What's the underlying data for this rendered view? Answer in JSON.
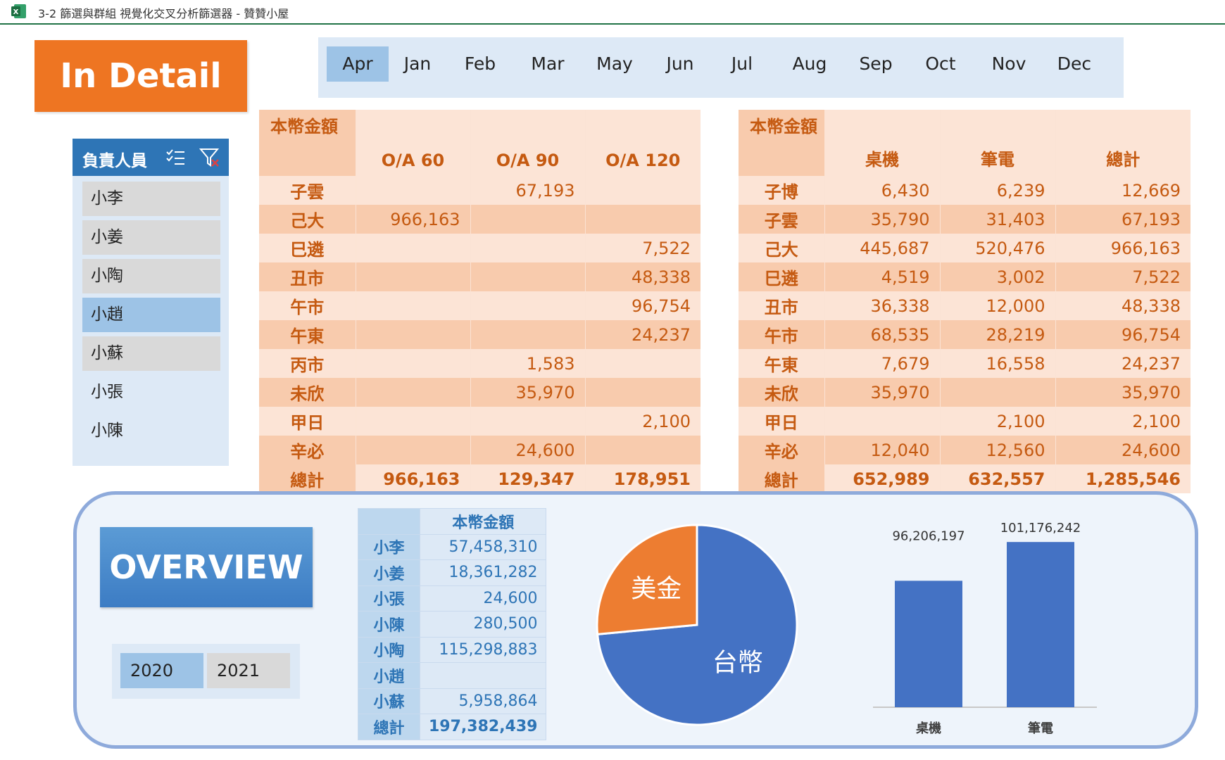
{
  "window": {
    "title": "3-2 篩選與群組 視覺化交叉分析篩選器 - 贊贊小屋",
    "app_icon": "excel-icon"
  },
  "banner": {
    "text": "In Detail"
  },
  "months": {
    "items": [
      "Apr",
      "Jan",
      "Feb",
      "Mar",
      "May",
      "Jun",
      "Jul",
      "Aug",
      "Sep",
      "Oct",
      "Nov",
      "Dec"
    ],
    "selected": "Apr"
  },
  "person_slicer": {
    "title": "負責人員",
    "items": [
      {
        "label": "小李",
        "state": "boxed"
      },
      {
        "label": "小姜",
        "state": "boxed"
      },
      {
        "label": "小陶",
        "state": "boxed"
      },
      {
        "label": "小趙",
        "state": "selected"
      },
      {
        "label": "小蘇",
        "state": "boxed"
      },
      {
        "label": "小張",
        "state": "plain"
      },
      {
        "label": "小陳",
        "state": "plain"
      }
    ]
  },
  "pivot1": {
    "corner": "本幣金額",
    "columns": [
      "O/A 60",
      "O/A 90",
      "O/A 120"
    ],
    "rows": [
      {
        "label": "子雲",
        "cells": [
          "",
          "67,193",
          ""
        ]
      },
      {
        "label": "己大",
        "cells": [
          "966,163",
          "",
          ""
        ]
      },
      {
        "label": "巳遴",
        "cells": [
          "",
          "",
          "7,522"
        ]
      },
      {
        "label": "丑市",
        "cells": [
          "",
          "",
          "48,338"
        ]
      },
      {
        "label": "午市",
        "cells": [
          "",
          "",
          "96,754"
        ]
      },
      {
        "label": "午東",
        "cells": [
          "",
          "",
          "24,237"
        ]
      },
      {
        "label": "丙市",
        "cells": [
          "",
          "1,583",
          ""
        ]
      },
      {
        "label": "未欣",
        "cells": [
          "",
          "35,970",
          ""
        ]
      },
      {
        "label": "甲日",
        "cells": [
          "",
          "",
          "2,100"
        ]
      },
      {
        "label": "辛必",
        "cells": [
          "",
          "24,600",
          ""
        ]
      }
    ],
    "total": {
      "label": "總計",
      "cells": [
        "966,163",
        "129,347",
        "178,951"
      ]
    }
  },
  "pivot2": {
    "corner": "本幣金額",
    "columns": [
      "桌機",
      "筆電",
      "總計"
    ],
    "rows": [
      {
        "label": "子博",
        "cells": [
          "6,430",
          "6,239",
          "12,669"
        ]
      },
      {
        "label": "子雲",
        "cells": [
          "35,790",
          "31,403",
          "67,193"
        ]
      },
      {
        "label": "己大",
        "cells": [
          "445,687",
          "520,476",
          "966,163"
        ]
      },
      {
        "label": "巳遴",
        "cells": [
          "4,519",
          "3,002",
          "7,522"
        ]
      },
      {
        "label": "丑市",
        "cells": [
          "36,338",
          "12,000",
          "48,338"
        ]
      },
      {
        "label": "午市",
        "cells": [
          "68,535",
          "28,219",
          "96,754"
        ]
      },
      {
        "label": "午東",
        "cells": [
          "7,679",
          "16,558",
          "24,237"
        ]
      },
      {
        "label": "未欣",
        "cells": [
          "35,970",
          "",
          "35,970"
        ]
      },
      {
        "label": "甲日",
        "cells": [
          "",
          "2,100",
          "2,100"
        ]
      },
      {
        "label": "辛必",
        "cells": [
          "12,040",
          "12,560",
          "24,600"
        ]
      }
    ],
    "total": {
      "label": "總計",
      "cells": [
        "652,989",
        "632,557",
        "1,285,546"
      ]
    }
  },
  "overview": {
    "banner": "OVERVIEW",
    "years": [
      {
        "label": "2020",
        "selected": true
      },
      {
        "label": "2021",
        "selected": false
      }
    ],
    "table": {
      "header": "本幣金額",
      "rows": [
        {
          "label": "小李",
          "value": "57,458,310"
        },
        {
          "label": "小姜",
          "value": "18,361,282"
        },
        {
          "label": "小張",
          "value": "24,600"
        },
        {
          "label": "小陳",
          "value": "280,500"
        },
        {
          "label": "小陶",
          "value": "115,298,883"
        },
        {
          "label": "小趙",
          "value": ""
        },
        {
          "label": "小蘇",
          "value": "5,958,864"
        }
      ],
      "total": {
        "label": "總計",
        "value": "197,382,439"
      }
    }
  },
  "chart_data": [
    {
      "type": "pie",
      "slices": [
        {
          "label": "台幣",
          "value": 73.5,
          "color": "#4472c4"
        },
        {
          "label": "美金",
          "value": 26.5,
          "color": "#ed7d31"
        }
      ]
    },
    {
      "type": "bar",
      "categories": [
        "桌機",
        "筆電"
      ],
      "values": [
        96206197,
        101176242
      ],
      "data_labels": [
        "96,206,197",
        "101,176,242"
      ],
      "color": "#4472c4",
      "ylim": [
        80000000,
        103000000
      ]
    }
  ]
}
